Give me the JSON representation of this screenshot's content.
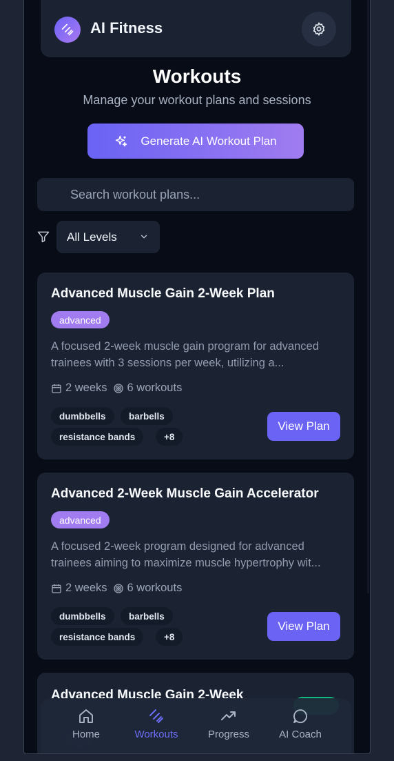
{
  "app": {
    "title": "AI Fitness"
  },
  "page": {
    "title": "Workouts",
    "subtitle": "Manage your workout plans and sessions",
    "generate_label": "Generate AI Workout Plan"
  },
  "search": {
    "placeholder": "Search workout plans..."
  },
  "filter": {
    "selected": "All Levels"
  },
  "plans": [
    {
      "title": "Advanced Muscle Gain 2-Week Plan",
      "level": "advanced",
      "description_line1": "A focused 2-week muscle gain program for advanced",
      "description_line2": "trainees with 3 sessions per week, utilizing a...",
      "duration": "2 weeks",
      "workouts": "6 workouts",
      "tags": [
        "dumbbells",
        "barbells",
        "resistance bands",
        "+8"
      ],
      "action": "View Plan"
    },
    {
      "title": "Advanced 2-Week Muscle Gain Accelerator",
      "level": "advanced",
      "description_line1": "A focused 2-week program designed for advanced",
      "description_line2": "trainees aiming to maximize muscle hypertrophy wit...",
      "duration": "2 weeks",
      "workouts": "6 workouts",
      "tags": [
        "dumbbells",
        "barbells",
        "resistance bands",
        "+8"
      ],
      "action": "View Plan"
    },
    {
      "title": "Advanced Muscle Gain 2-Week"
    }
  ],
  "nav": [
    {
      "label": "Home",
      "icon": "home-icon"
    },
    {
      "label": "Workouts",
      "icon": "dumbbell-icon",
      "active": true
    },
    {
      "label": "Progress",
      "icon": "trending-up-icon"
    },
    {
      "label": "AI Coach",
      "icon": "chat-icon"
    }
  ],
  "colors": {
    "accent": "#6a63f4",
    "accent2": "#a07cf0",
    "bg": "#080c16",
    "card": "#1b2333"
  }
}
